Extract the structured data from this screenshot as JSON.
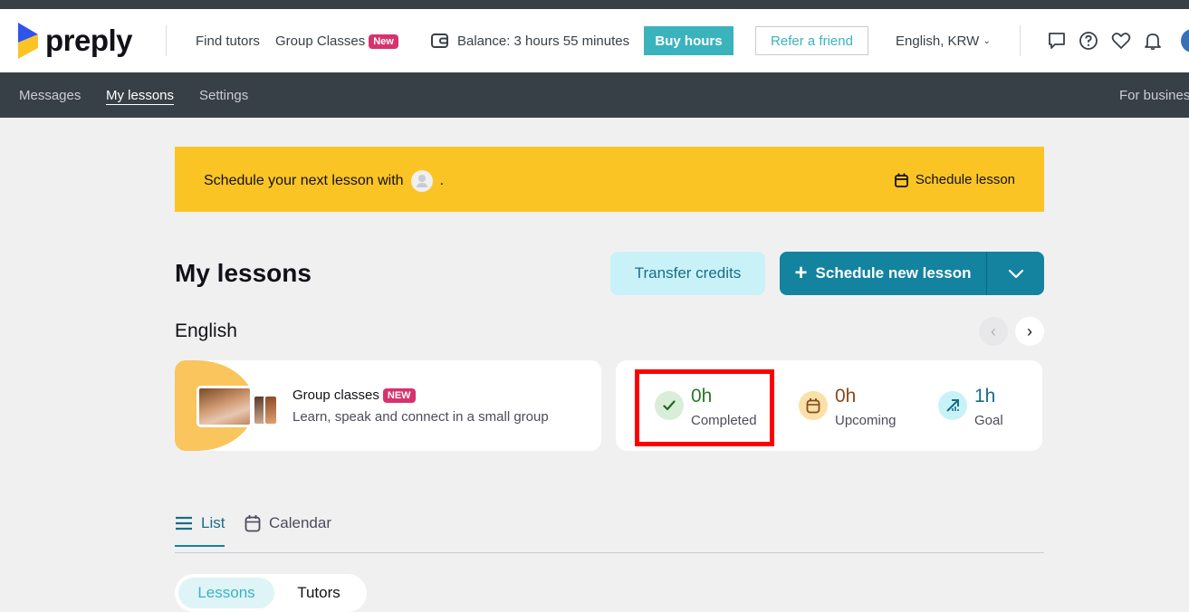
{
  "header": {
    "logo_text": "preply",
    "nav": {
      "find_tutors": "Find tutors",
      "group_classes": "Group Classes",
      "new_badge": "New"
    },
    "balance": "Balance: 3 hours 55 minutes",
    "buy_hours": "Buy hours",
    "refer_friend": "Refer a friend",
    "language": "English, KRW",
    "icons": [
      "chat-icon",
      "help-icon",
      "heart-icon",
      "bell-icon",
      "avatar"
    ]
  },
  "subnav": {
    "messages": "Messages",
    "my_lessons": "My lessons",
    "settings": "Settings",
    "for_business": "For business"
  },
  "banner": {
    "text_before": "Schedule your next lesson with",
    "text_after": ".",
    "action": "Schedule lesson"
  },
  "main": {
    "title": "My lessons",
    "transfer_credits": "Transfer credits",
    "schedule_new": "Schedule new lesson",
    "section": "English",
    "group_card": {
      "title": "Group classes",
      "badge": "NEW",
      "subtitle": "Learn, speak and connect in a small group"
    },
    "stats": [
      {
        "value": "0h",
        "label": "Completed",
        "icon": "check-icon"
      },
      {
        "value": "0h",
        "label": "Upcoming",
        "icon": "calendar-icon"
      },
      {
        "value": "1h",
        "label": "Goal",
        "icon": "goal-icon"
      }
    ],
    "colors": {
      "completed": "#2a7a2a",
      "upcoming": "#8a4a1a",
      "goal": "#1a6d86",
      "accent": "#13839f",
      "highlight": "#ff0000"
    },
    "tabs": {
      "list": "List",
      "calendar": "Calendar"
    },
    "segments": {
      "lessons": "Lessons",
      "tutors": "Tutors"
    }
  }
}
